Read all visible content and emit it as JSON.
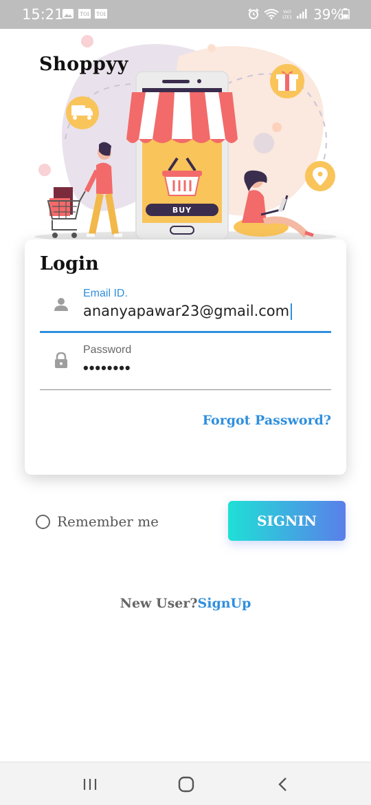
{
  "status_bar": {
    "time": "15:21",
    "left_icons": [
      "gallery-icon",
      "toi-icon",
      "toi-icon"
    ],
    "right_icons": [
      "alarm-icon",
      "wifi-icon",
      "volte-lte-icon",
      "signal-icon",
      "battery-icon"
    ],
    "battery": "39%"
  },
  "app": {
    "brand": "Shoppyy",
    "illustration_button": "BUY"
  },
  "login": {
    "title": "Login",
    "email_label": "Email ID.",
    "email_value": "ananyapawar23@gmail.com",
    "password_label": "Password",
    "password_value": "••••••••",
    "forgot_link": "Forgot Password?"
  },
  "actions": {
    "remember_label": "Remember me",
    "signin_label": "SIGNIN",
    "new_user_text": "New User?",
    "signup_link": "SignUp"
  },
  "colors": {
    "accent": "#2f8fde",
    "signin_gradient_start": "#1fe0d6",
    "signin_gradient_end": "#5a7fea",
    "awning_red": "#f26a6a",
    "basket_yellow": "#f9c45a"
  },
  "nav_bar": {
    "icons": [
      "recents-icon",
      "home-icon",
      "back-icon"
    ]
  }
}
